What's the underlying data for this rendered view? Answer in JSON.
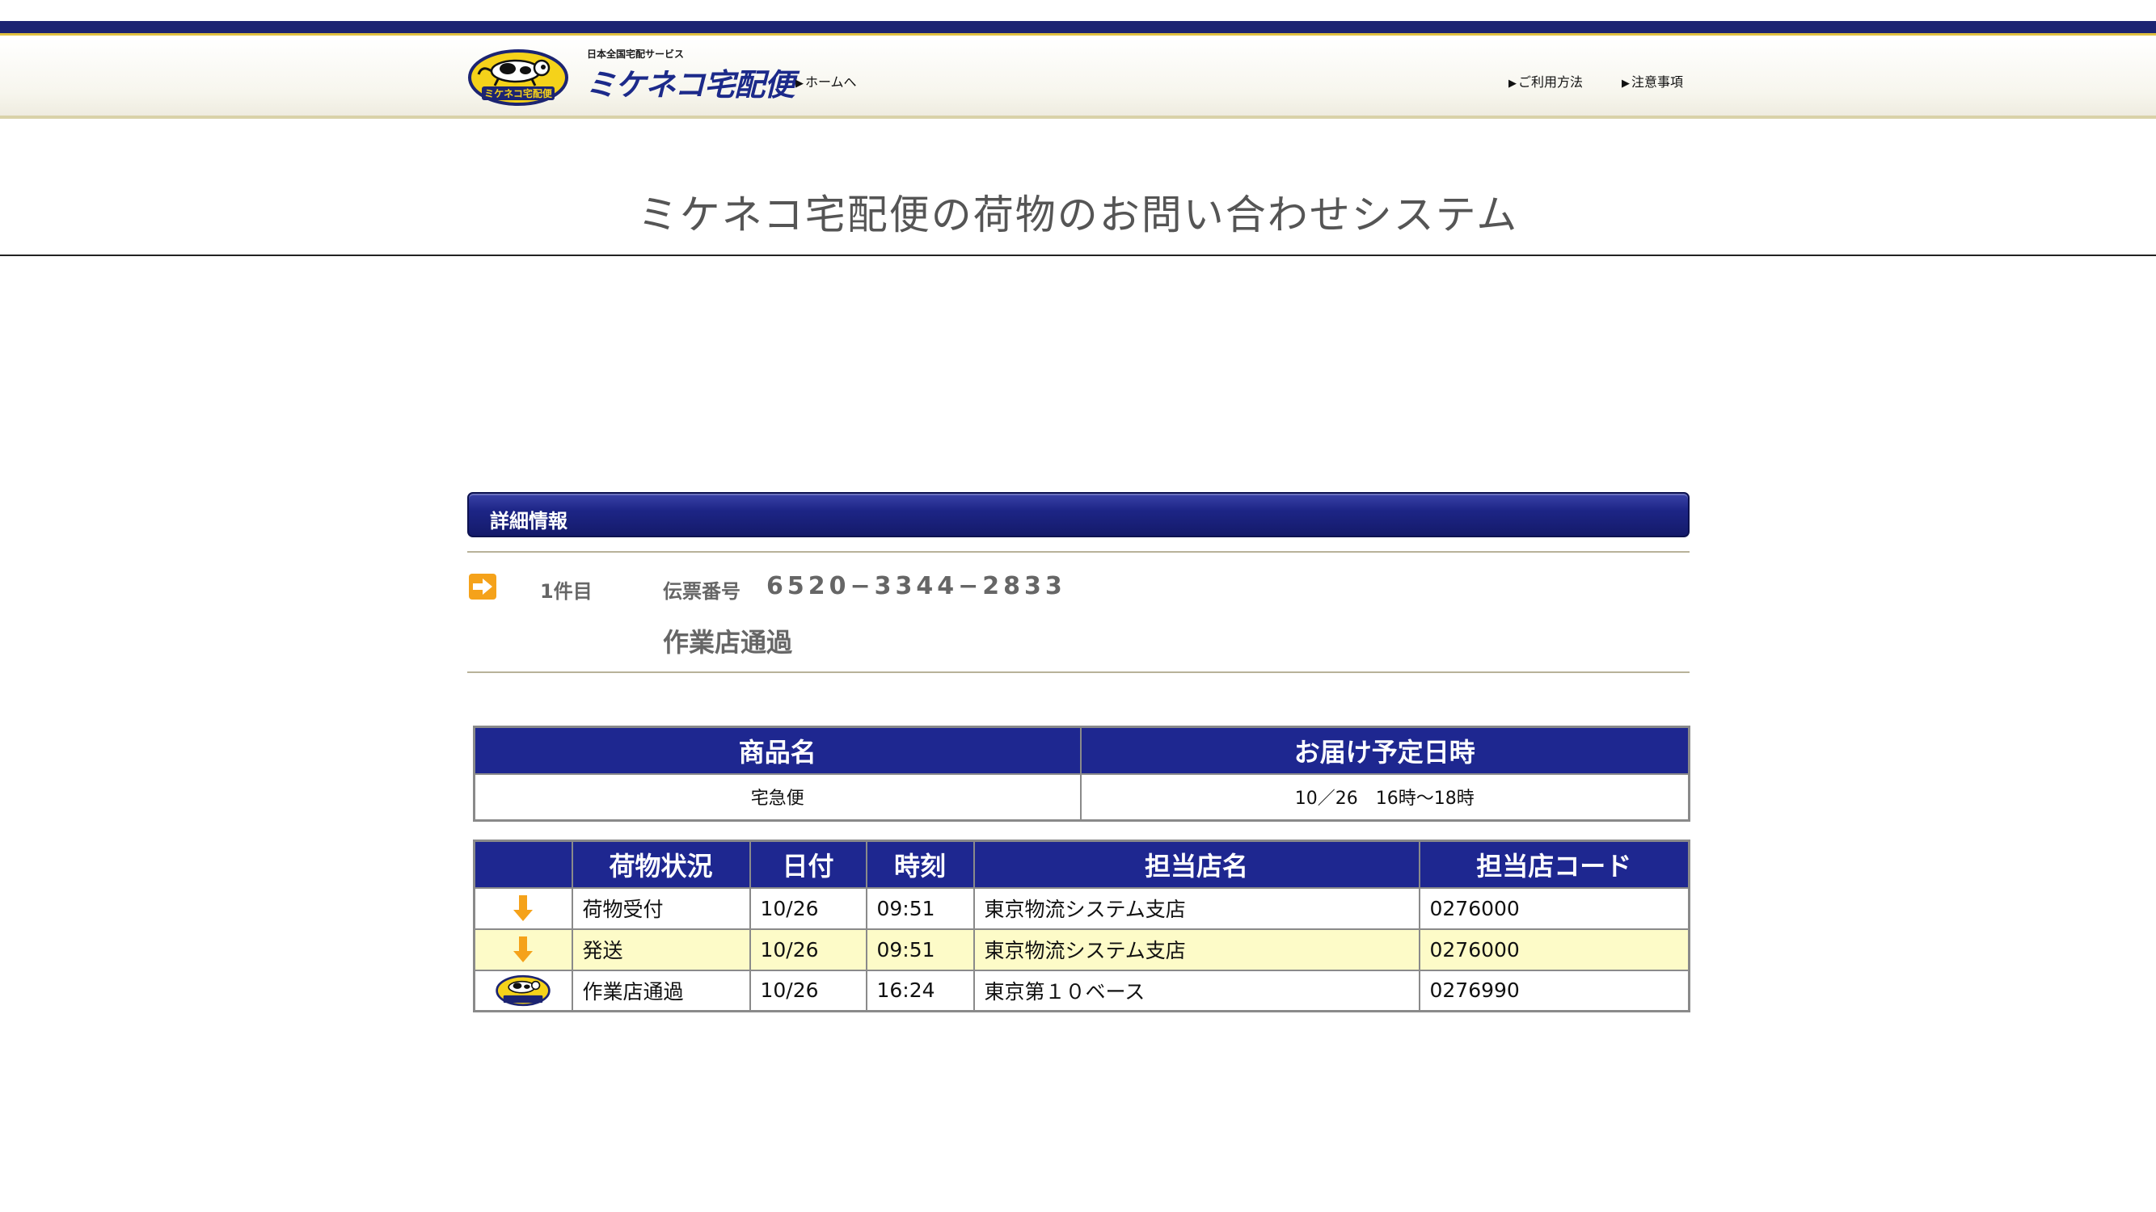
{
  "header": {
    "tagline": "日本全国宅配サービス",
    "logo_text": "ミケネコ宅配便",
    "logo_badge_text": "ミケネコ宅配便",
    "nav": {
      "home": "ホームへ",
      "usage": "ご利用方法",
      "notes": "注意事項"
    }
  },
  "page_title": "ミケネコ宅配便の荷物のお問い合わせシステム",
  "section": {
    "title": "詳細情報"
  },
  "item": {
    "index": "1件目",
    "slip_label": "伝票番号",
    "slip_number": "6520−3344−2833",
    "current_status": "作業店通過"
  },
  "product_table": {
    "headers": [
      "商品名",
      "お届け予定日時"
    ],
    "row": [
      "宅急便",
      "10／26　16時〜18時"
    ]
  },
  "status_table": {
    "headers": [
      "",
      "荷物状況",
      "日付",
      "時刻",
      "担当店名",
      "担当店コード"
    ],
    "rows": [
      {
        "icon": "down-arrow-icon",
        "status": "荷物受付",
        "date": "10/26",
        "time": "09:51",
        "store": "東京物流システム支店",
        "code": "0276000",
        "highlighted": false
      },
      {
        "icon": "down-arrow-icon",
        "status": "発送",
        "date": "10/26",
        "time": "09:51",
        "store": "東京物流システム支店",
        "code": "0276000",
        "highlighted": true
      },
      {
        "icon": "cat-logo-icon",
        "status": "作業店通過",
        "date": "10/26",
        "time": "16:24",
        "store": "東京第１０ベース",
        "code": "0276990",
        "highlighted": false
      }
    ]
  },
  "colors": {
    "navy": "#1e2790",
    "accent_orange": "#f5a21a",
    "highlight_row": "#fdfbc8",
    "logo_yellow": "#f5d21a"
  }
}
